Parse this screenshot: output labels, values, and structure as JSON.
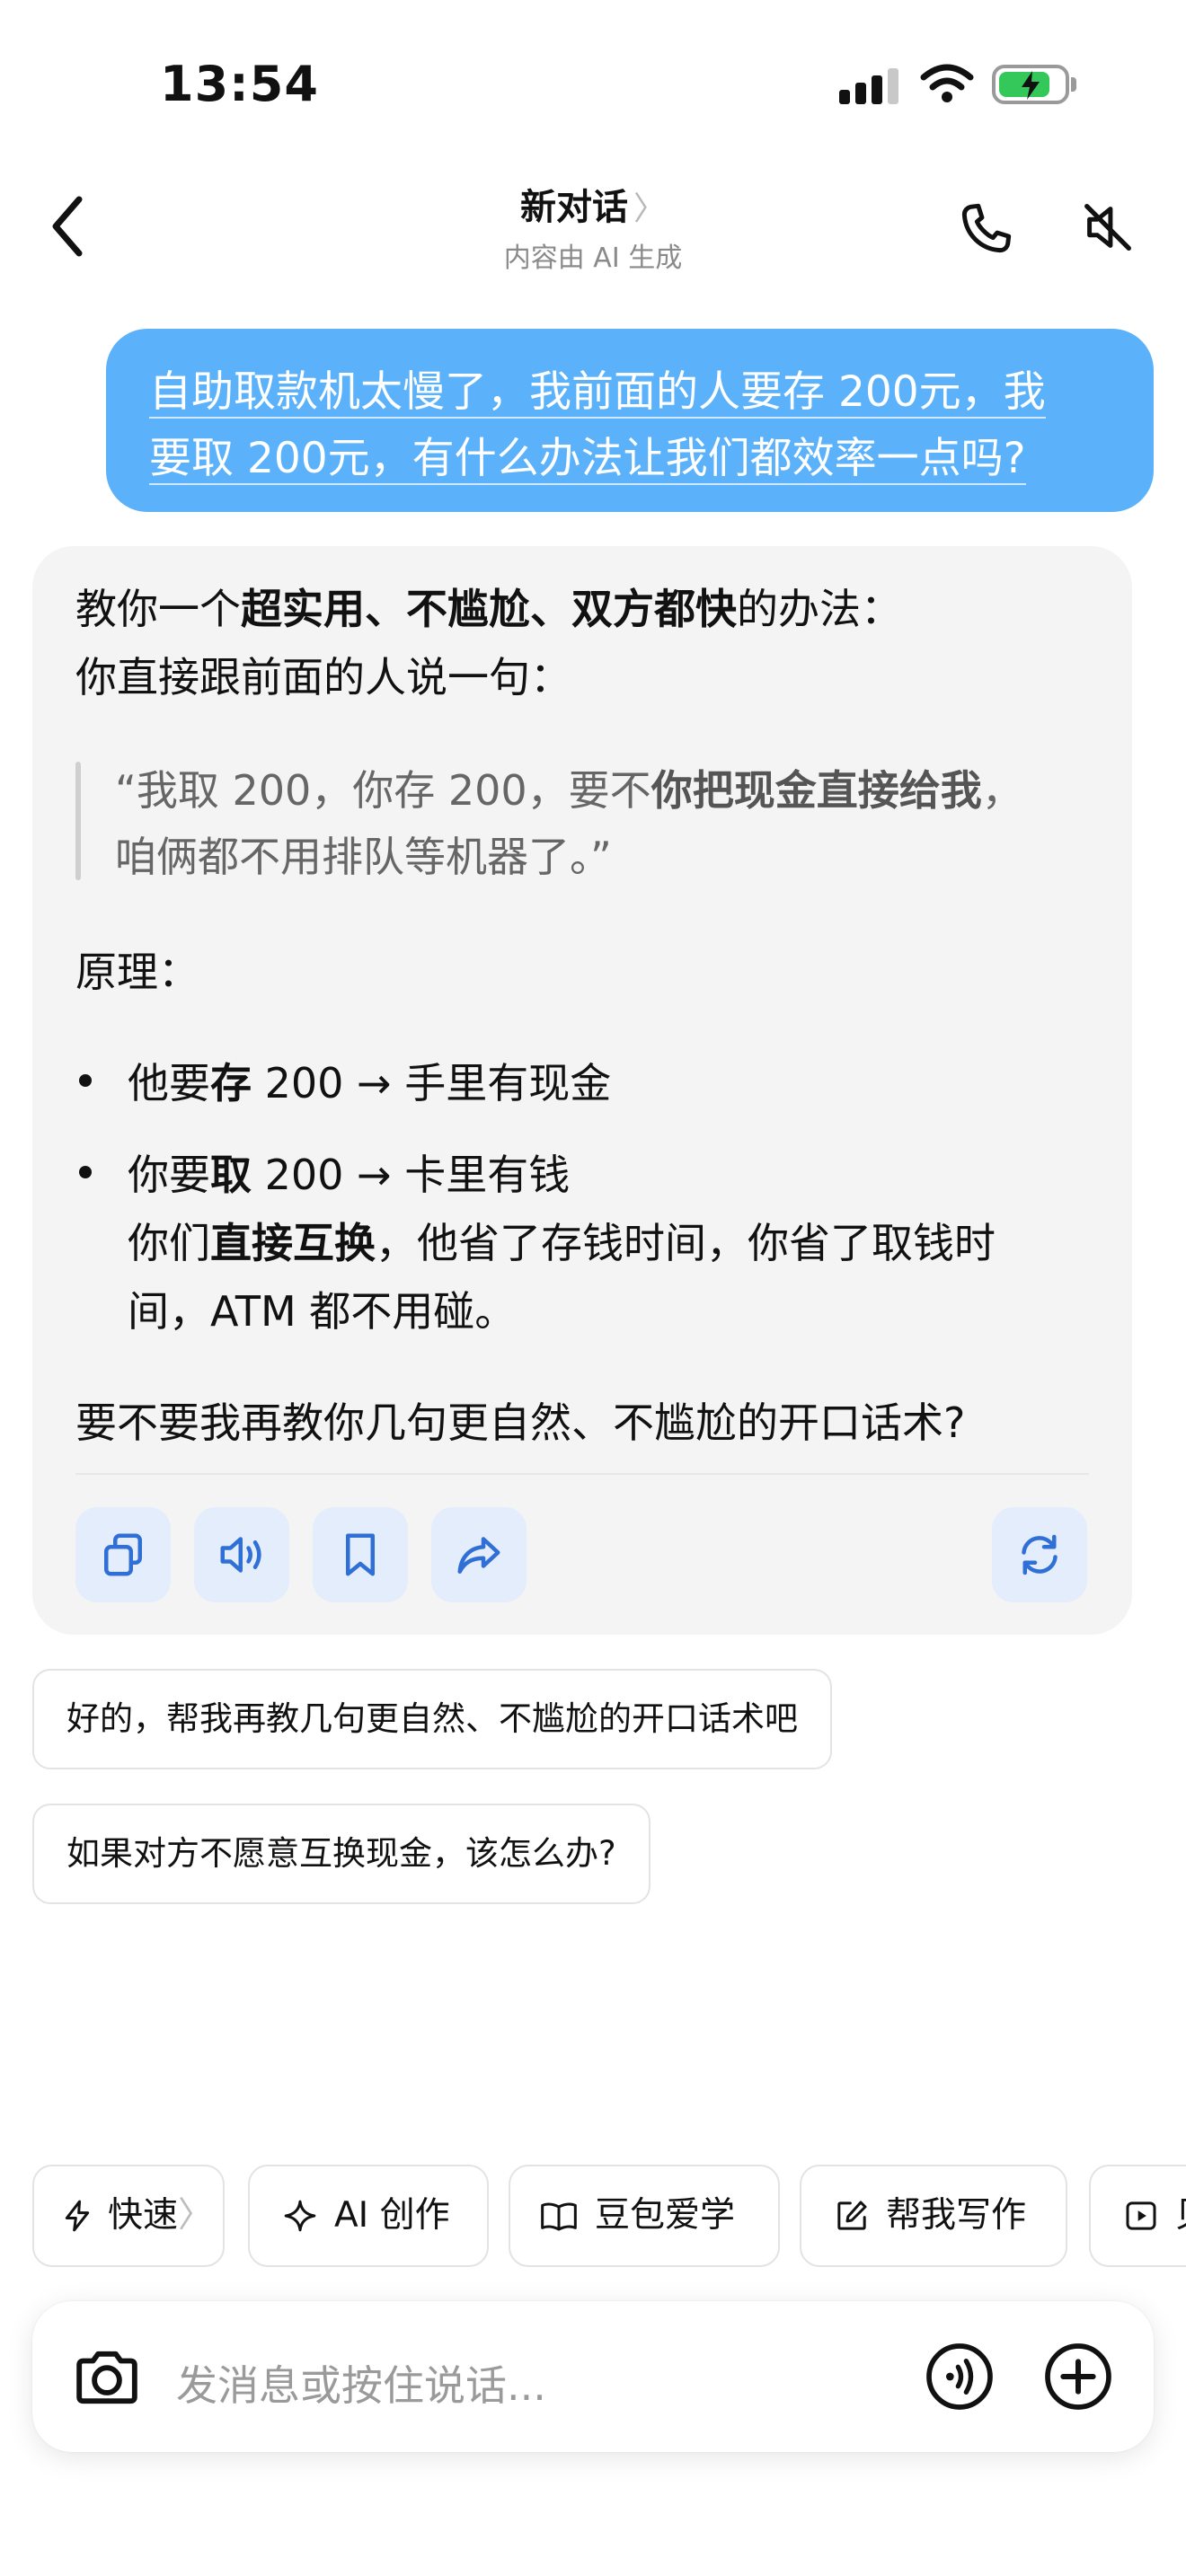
{
  "status_bar": {
    "time": "13:54"
  },
  "nav": {
    "title": "新对话",
    "title_chevron": "〉",
    "subtitle": "内容由 AI 生成",
    "icons": [
      "back-icon",
      "phone-icon",
      "speaker-muted-icon"
    ]
  },
  "user_message": {
    "line1": "自助取款机太慢了，我前面的人要存 200元，我",
    "line2": "要取 200元，有什么办法让我们都效率一点吗?"
  },
  "ai_message": {
    "intro_a": "教你一个",
    "intro_b": "超实用、不尴尬、双方都快",
    "intro_c": "的办法：",
    "line2": "你直接跟前面的人说一句：",
    "quote_l1_a": "“我取 200，你存 200，要不",
    "quote_l1_b": "你把现金直接给我",
    "quote_l1_c": "，",
    "quote_l2": "咱俩都不用排队等机器了。”",
    "principle": "原理：",
    "b1_a": "他要",
    "b1_b": "存",
    "b1_c": " 200 → 手里有现金",
    "b2_a": "你要",
    "b2_b": "取",
    "b2_c": " 200 → 卡里有钱",
    "b2_l2_a": "你们",
    "b2_l2_b": "直接互换",
    "b2_l2_c": "，他省了存钱时间，你省了取钱时",
    "b2_l3": "间，ATM 都不用碰。",
    "closing": "要不要我再教你几句更自然、不尴尬的开口话术?"
  },
  "actions": [
    "copy-icon",
    "speaker-icon",
    "bookmark-icon",
    "share-icon",
    "regenerate-icon"
  ],
  "suggestions": [
    "好的，帮我再教几句更自然、不尴尬的开口话术吧",
    "如果对方不愿意互换现金，该怎么办?"
  ],
  "chips": {
    "fast": "快速",
    "fast_chevron": "〉",
    "ai_create": "AI 创作",
    "doubao_learn": "豆包爱学",
    "help_write": "帮我写作",
    "partial": "贝"
  },
  "input": {
    "placeholder": "发消息或按住说话..."
  },
  "colors": {
    "accent": "#5bb2fb",
    "action_bg": "#e3edfb",
    "icon_blue": "#2f6fd6"
  }
}
